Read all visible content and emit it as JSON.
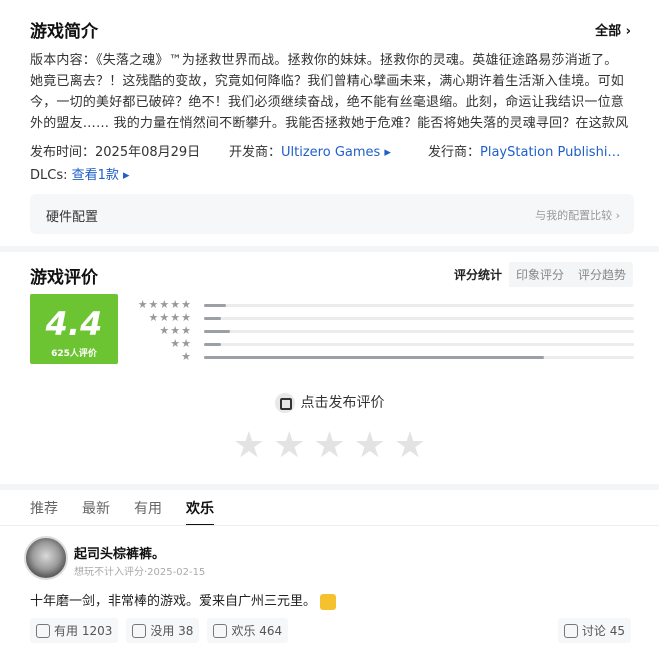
{
  "intro": {
    "title": "游戏简介",
    "all_label": "全部",
    "description": "版本内容：《失落之魂》™为拯救世界而战。拯救你的妹妹。拯救你的灵魂。英雄征途路易莎消逝了。她竟已离去？！这残酷的变故，究竟如何降临？我们曾精心擘画未来，满心期许着生活渐入佳境。可如今，一切的美好都已破碎？绝不！我们必须继续奋战，绝不能有丝毫退缩。此刻，命运让我结识一位意外的盟友…… 我的力量在悄然间不断攀升。我能否拯救她于危难？能否将她失落的灵魂寻回？在这款风格卓绝…",
    "release_label": "发布时间：",
    "release_date": "2025年08月29日",
    "developer_label": "开发商：",
    "developer": "Ultizero Games",
    "publisher_label": "发行商：",
    "publisher": "PlayStation Publishi…",
    "dlc_label": "DLCs:",
    "dlc_link": "查看1款",
    "hardware_label": "硬件配置",
    "hardware_compare": "与我的配置比较"
  },
  "rating": {
    "title": "游戏评价",
    "tabs": [
      "评分统计",
      "印象评分",
      "评分趋势"
    ],
    "score": "4.4",
    "count_label": "625人评价",
    "distribution": [
      {
        "stars": "★★★★★",
        "fraction": 0.05
      },
      {
        "stars": "★★★★",
        "fraction": 0.04
      },
      {
        "stars": "★★★",
        "fraction": 0.06
      },
      {
        "stars": "★★",
        "fraction": 0.04
      },
      {
        "stars": "★",
        "fraction": 0.79
      }
    ],
    "post_label": "点击发布评价",
    "empty_stars": [
      "★",
      "★",
      "★",
      "★",
      "★"
    ]
  },
  "reviews": {
    "tabs": [
      "推荐",
      "最新",
      "有用",
      "欢乐"
    ],
    "active_tab": 3,
    "item": {
      "username": "起司头棕裤裤。",
      "meta": "想玩不计入评分·2025-02-15",
      "text": "十年磨一剑，非常棒的游戏。爱来自广州三元里。",
      "useful_label": "有用 1203",
      "useless_label": "没用 38",
      "fun_label": "欢乐 464",
      "discuss_label": "讨论 45"
    }
  }
}
